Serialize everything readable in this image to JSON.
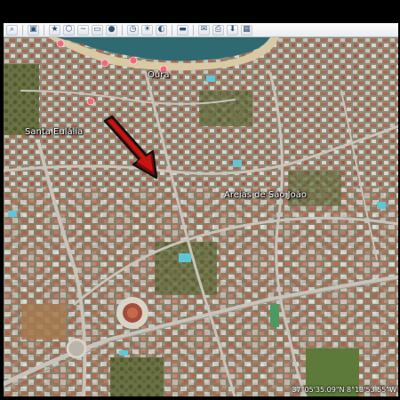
{
  "toolbar": {
    "buttons": [
      {
        "icon": "search-icon",
        "glyph": "🔍"
      },
      {
        "icon": "sidebar-icon",
        "glyph": "▣"
      },
      {
        "icon": "add-placemark-icon",
        "glyph": "★"
      },
      {
        "icon": "add-polygon-icon",
        "glyph": "⬡"
      },
      {
        "icon": "add-path-icon",
        "glyph": "〰"
      },
      {
        "icon": "add-overlay-icon",
        "glyph": "▭"
      },
      {
        "icon": "record-tour-icon",
        "glyph": "●"
      },
      {
        "icon": "historical-imagery-icon",
        "glyph": "◷"
      },
      {
        "icon": "sunlight-icon",
        "glyph": "☀"
      },
      {
        "icon": "planets-icon",
        "glyph": "◐"
      },
      {
        "icon": "ruler-icon",
        "glyph": "📏"
      },
      {
        "icon": "email-icon",
        "glyph": "✉"
      },
      {
        "icon": "print-icon",
        "glyph": "🖶"
      },
      {
        "icon": "save-image-icon",
        "glyph": "🖫"
      },
      {
        "icon": "view-in-maps-icon",
        "glyph": "▦"
      }
    ]
  },
  "map": {
    "labels": {
      "oura": "Oura",
      "santa_eulalia": "Santa Eulália",
      "areias_sao_joao": "Areias de São João"
    },
    "arrow_color": "#c51512",
    "pin_color": "#f06a7a",
    "sea_color": "#2f6a72"
  },
  "status_bar": {
    "coordinates": "37°05'35.09\"N    8°13'53.55\"W"
  }
}
